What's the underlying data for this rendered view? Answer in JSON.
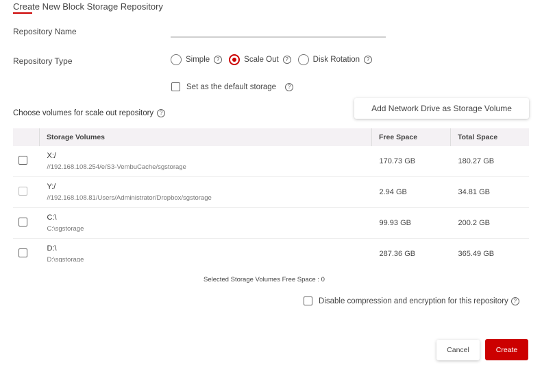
{
  "dialog": {
    "title": "Create New Block Storage Repository",
    "accent_color": "#cc0000"
  },
  "form": {
    "repository_name_label": "Repository Name",
    "repository_name_value": "",
    "repository_type_label": "Repository Type",
    "repository_types": [
      {
        "label": "Simple",
        "selected": false
      },
      {
        "label": "Scale Out",
        "selected": true
      },
      {
        "label": "Disk Rotation",
        "selected": false
      }
    ],
    "default_storage_label": "Set as the default storage",
    "default_storage_checked": false
  },
  "volumes": {
    "section_label": "Choose volumes for scale out repository",
    "add_button_label": "Add Network Drive as Storage Volume",
    "columns": [
      "Storage Volumes",
      "Free Space",
      "Total Space"
    ],
    "rows": [
      {
        "name": "X:/",
        "path": "//192.168.108.254/e/S3-VembuCache/sgstorage",
        "free": "170.73 GB",
        "total": "180.27 GB",
        "disabled": false
      },
      {
        "name": "Y:/",
        "path": "//192.168.108.81/Users/Administrator/Dropbox/sgstorage",
        "free": "2.94 GB",
        "total": "34.81 GB",
        "disabled": true
      },
      {
        "name": "C:\\",
        "path": "C:\\sgstorage",
        "free": "99.93 GB",
        "total": "200.2 GB",
        "disabled": false
      },
      {
        "name": "D:\\",
        "path": "D:\\sgstorage",
        "free": "287.36 GB",
        "total": "365.49 GB",
        "disabled": false
      }
    ],
    "selected_free_space_text": "Selected Storage Volumes Free Space : 0"
  },
  "options": {
    "disable_compression_label": "Disable compression and encryption for this repository",
    "disable_compression_checked": false
  },
  "actions": {
    "cancel_label": "Cancel",
    "create_label": "Create"
  }
}
